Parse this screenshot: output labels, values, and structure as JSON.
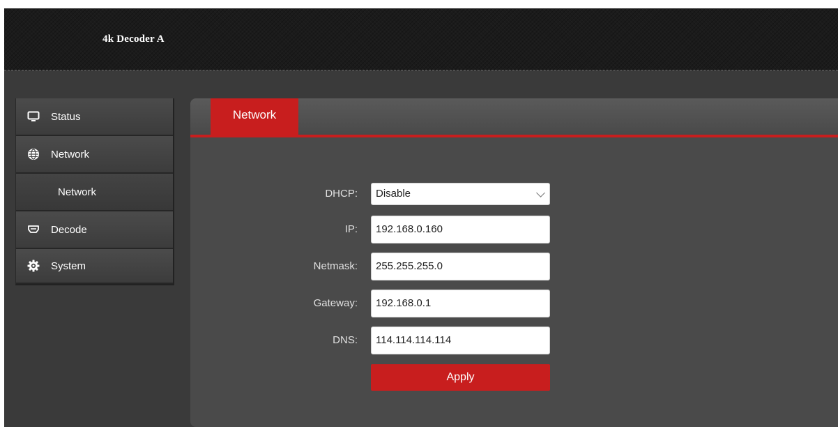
{
  "header": {
    "title": "4k Decoder  A"
  },
  "sidebar": {
    "items": [
      {
        "label": "Status",
        "icon": "monitor-icon"
      },
      {
        "label": "Network",
        "icon": "globe-icon"
      },
      {
        "label": "Network",
        "icon": ""
      },
      {
        "label": "Decode",
        "icon": "hdmi-icon"
      },
      {
        "label": "System",
        "icon": "gear-icon"
      }
    ]
  },
  "main": {
    "tab_label": "Network",
    "fields": {
      "dhcp": {
        "label": "DHCP:",
        "value": "Disable"
      },
      "ip": {
        "label": "IP:",
        "value": "192.168.0.160"
      },
      "netmask": {
        "label": "Netmask:",
        "value": "255.255.255.0"
      },
      "gateway": {
        "label": "Gateway:",
        "value": "192.168.0.1"
      },
      "dns": {
        "label": "DNS:",
        "value": "114.114.114.114"
      }
    },
    "apply_label": "Apply"
  },
  "colors": {
    "accent": "#c81e1e",
    "header_bg": "#1b1b1b",
    "panel_bg": "#4a4a4a"
  }
}
